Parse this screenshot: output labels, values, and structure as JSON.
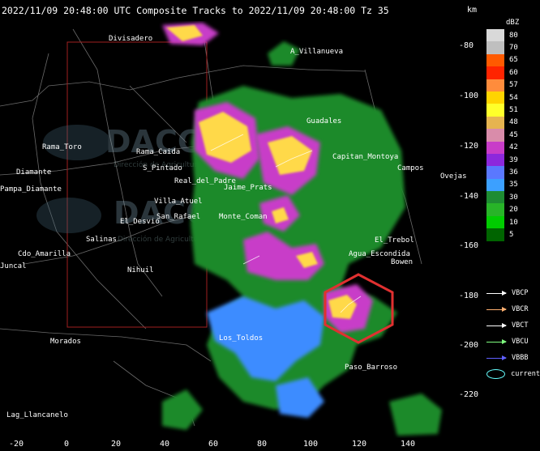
{
  "header": {
    "title": "2022/11/09 20:48:00 UTC Composite Tracks to 2022/11/09 20:48:00 Tz 35",
    "km_label": "km",
    "dbz_label": "dBZ"
  },
  "axes": {
    "x_ticks": [
      "-20",
      "0",
      "20",
      "40",
      "60",
      "80",
      "100",
      "120",
      "140"
    ],
    "y_ticks": [
      "-80",
      "-100",
      "-120",
      "-140",
      "-160",
      "-180",
      "-200",
      "-220"
    ]
  },
  "legend": {
    "levels": [
      {
        "value": "80",
        "color": "#d9d9d9"
      },
      {
        "value": "70",
        "color": "#bfbfbf"
      },
      {
        "value": "65",
        "color": "#ff5a00"
      },
      {
        "value": "60",
        "color": "#ff2400"
      },
      {
        "value": "57",
        "color": "#ff8c3c"
      },
      {
        "value": "54",
        "color": "#ffd400"
      },
      {
        "value": "51",
        "color": "#ffff2a"
      },
      {
        "value": "48",
        "color": "#e6b450"
      },
      {
        "value": "45",
        "color": "#d98caa"
      },
      {
        "value": "42",
        "color": "#c83cc8"
      },
      {
        "value": "39",
        "color": "#8c28dc"
      },
      {
        "value": "36",
        "color": "#5a78ff"
      },
      {
        "value": "35",
        "color": "#3ca0ff"
      },
      {
        "value": "30",
        "color": "#1e8c32"
      },
      {
        "value": "20",
        "color": "#28b428"
      },
      {
        "value": "10",
        "color": "#00cc00"
      },
      {
        "value": "5",
        "color": "#006400"
      }
    ],
    "tracks": [
      {
        "label": "VBCP",
        "color": "#ffffff"
      },
      {
        "label": "VBCR",
        "color": "#ffb070"
      },
      {
        "label": "VBCT",
        "color": "#ffffff"
      },
      {
        "label": "VBCU",
        "color": "#80ff80"
      },
      {
        "label": "VBBB",
        "color": "#6060ff"
      }
    ],
    "current_label": "current"
  },
  "places": [
    "Divisadero",
    "A_Villanueva",
    "Guadales",
    "Rama_Caida",
    "S_Pintado",
    "Real_del_Padre",
    "Jaime_Prats",
    "Monte_Coman",
    "San_Rafael",
    "El_Desvio",
    "Villa_Atuel",
    "Salinas",
    "Cdo_Amarilla",
    "Nihuil",
    "Morados",
    "Los_Toldos",
    "Paso_Barroso",
    "Lag_Llancanelo",
    "Bowen",
    "Campos",
    "Ovejas",
    "El_Trebol",
    "Agua_Escondida",
    "Rama_Toro",
    "Capitan_Montoya",
    "Pampa_Diamante",
    "Diamante",
    "Juncal"
  ],
  "watermark": {
    "text": "DACC",
    "subtitle": "Dirección de Agricultura y Contingencias Climáticas"
  }
}
